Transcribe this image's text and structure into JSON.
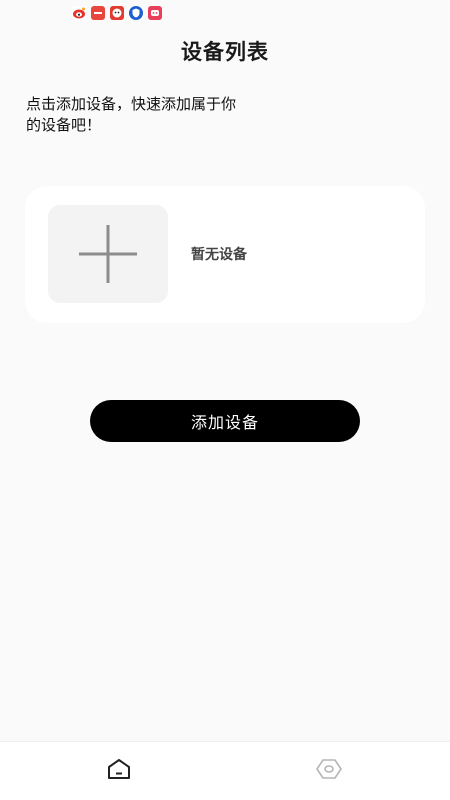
{
  "status_bar": {
    "time": "",
    "right_text": ""
  },
  "header": {
    "title": "设备列表"
  },
  "intro": {
    "text": "点击添加设备，快速添加属于你的设备吧！"
  },
  "device_card": {
    "empty_text": "暂无设备",
    "add_icon": "plus-icon"
  },
  "actions": {
    "add_device_label": "添加设备"
  },
  "bottom_nav": {
    "items": [
      {
        "icon": "home-icon"
      },
      {
        "icon": "device-hex-icon"
      }
    ]
  },
  "colors": {
    "background": "#fafafa",
    "card": "#ffffff",
    "tile": "#f3f3f3",
    "button": "#000000",
    "button_text": "#ffffff"
  }
}
